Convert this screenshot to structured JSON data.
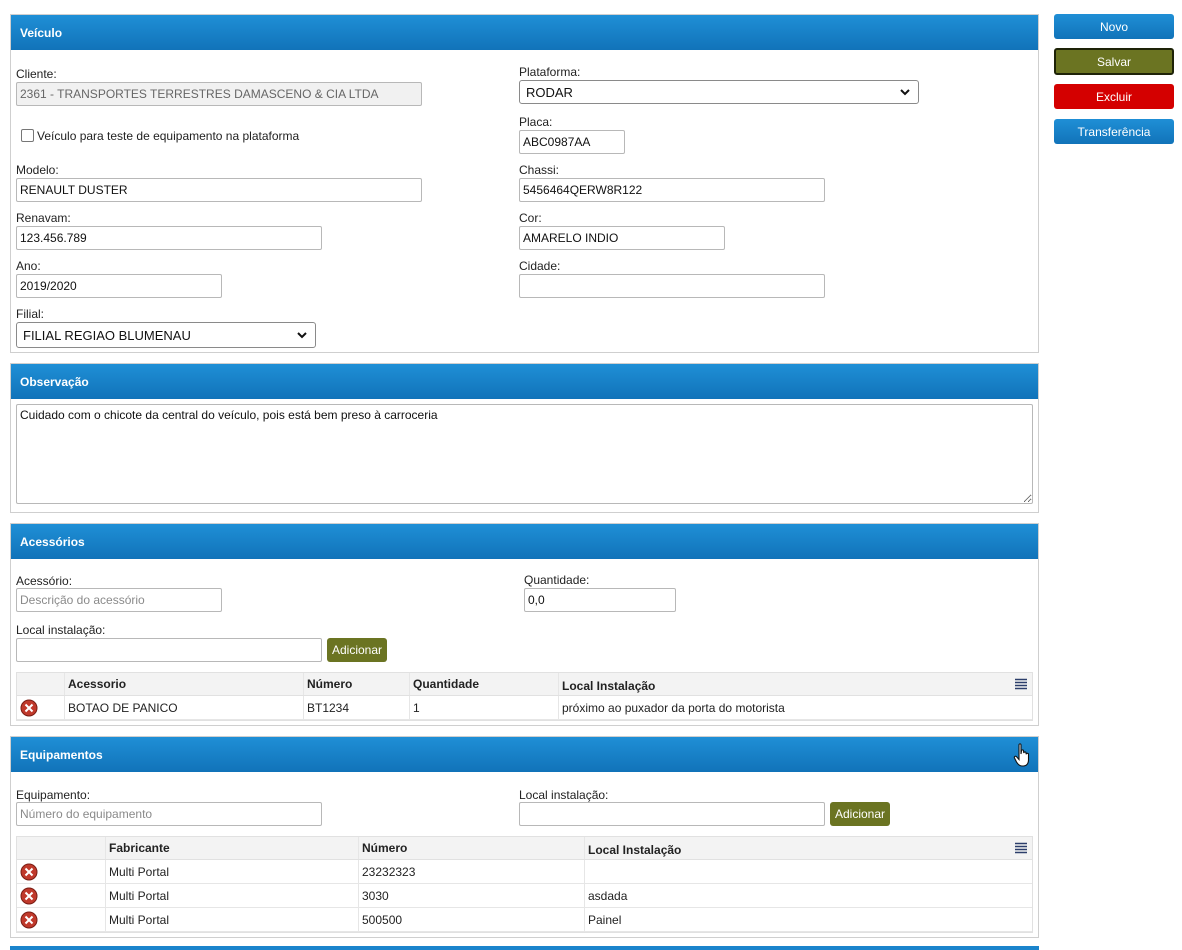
{
  "actions": {
    "novo": "Novo",
    "salvar": "Salvar",
    "excluir": "Excluir",
    "transferencia": "Transferência"
  },
  "veiculo": {
    "title": "Veículo",
    "cliente_label": "Cliente:",
    "cliente_value": "2361 - TRANSPORTES TERRESTRES DAMASCENO & CIA LTDA",
    "plataforma_label": "Plataforma:",
    "plataforma_value": "RODAR",
    "teste_label": "Veículo para teste de equipamento na plataforma",
    "placa_label": "Placa:",
    "placa_value": "ABC0987AA",
    "modelo_label": "Modelo:",
    "modelo_value": "RENAULT DUSTER",
    "chassi_label": "Chassi:",
    "chassi_value": "5456464QERW8R122",
    "renavam_label": "Renavam:",
    "renavam_value": "123.456.789",
    "cor_label": "Cor:",
    "cor_value": "AMARELO INDIO",
    "ano_label": "Ano:",
    "ano_value": "2019/2020",
    "cidade_label": "Cidade:",
    "cidade_value": "",
    "filial_label": "Filial:",
    "filial_value": "FILIAL REGIAO BLUMENAU"
  },
  "observacao": {
    "title": "Observação",
    "text": "Cuidado com o chicote da central do veículo, pois está bem preso à carroceria"
  },
  "acessorios": {
    "title": "Acessórios",
    "acessorio_label": "Acessório:",
    "acessorio_placeholder": "Descrição do acessório",
    "quantidade_label": "Quantidade:",
    "quantidade_value": "0,0",
    "local_label": "Local instalação:",
    "local_value": "",
    "add_label": "Adicionar",
    "columns": [
      "Acessorio",
      "Número",
      "Quantidade",
      "Local Instalação"
    ],
    "rows": [
      [
        "BOTAO DE PANICO",
        "BT1234",
        "1",
        "próximo ao puxador da porta do motorista"
      ]
    ]
  },
  "equipamentos": {
    "title": "Equipamentos",
    "equipamento_label": "Equipamento:",
    "equipamento_placeholder": "Número do equipamento",
    "local_label": "Local instalação:",
    "local_value": "",
    "add_label": "Adicionar",
    "columns": [
      "Fabricante",
      "Número",
      "Local Instalação"
    ],
    "rows": [
      [
        "Multi Portal",
        "23232323",
        ""
      ],
      [
        "Multi Portal",
        "3030",
        "asdada"
      ],
      [
        "Multi Portal",
        "500500",
        "Painel"
      ]
    ]
  },
  "icons": {
    "delete": "delete-circle-icon",
    "menu": "hamburger-menu-icon",
    "cursor": "hand-pointer-icon",
    "chevron": "chevron-down-icon"
  },
  "colors": {
    "header_blue": "#1173b9",
    "olive": "#6b7422",
    "danger": "#d40000"
  }
}
